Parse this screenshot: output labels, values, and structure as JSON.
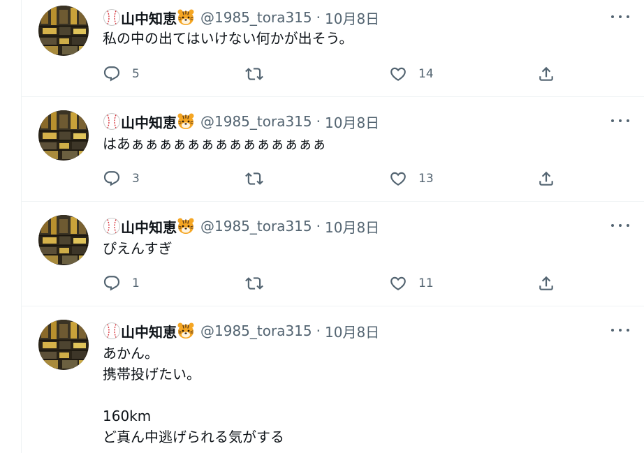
{
  "tweets": [
    {
      "display_name": "山中知恵",
      "handle": "@1985_tora315",
      "separator": "·",
      "date": "10月8日",
      "text": "私の中の出てはいけない何かが出そう。",
      "replies": "5",
      "retweets": "",
      "likes": "14"
    },
    {
      "display_name": "山中知恵",
      "handle": "@1985_tora315",
      "separator": "·",
      "date": "10月8日",
      "text": "はあぁぁぁぁぁぁぁぁぁぁぁぁぁぁ",
      "replies": "3",
      "retweets": "",
      "likes": "13"
    },
    {
      "display_name": "山中知恵",
      "handle": "@1985_tora315",
      "separator": "·",
      "date": "10月8日",
      "text": "ぴえんすぎ",
      "replies": "1",
      "retweets": "",
      "likes": "11"
    },
    {
      "display_name": "山中知恵",
      "handle": "@1985_tora315",
      "separator": "·",
      "date": "10月8日",
      "text": "あかん。\n携帯投げたい。\n\n160km\nど真ん中逃げられる気がする",
      "replies": "",
      "retweets": "",
      "likes": ""
    }
  ],
  "colors": {
    "text_primary": "#0f1419",
    "text_secondary": "#536471",
    "divider": "#eff3f4"
  },
  "icons": {
    "name_prefix": "baseball-emoji",
    "name_suffix": "tiger-face-emoji",
    "reply": "reply-icon",
    "retweet": "retweet-icon",
    "like": "heart-icon",
    "share": "share-icon",
    "more": "more-icon"
  }
}
